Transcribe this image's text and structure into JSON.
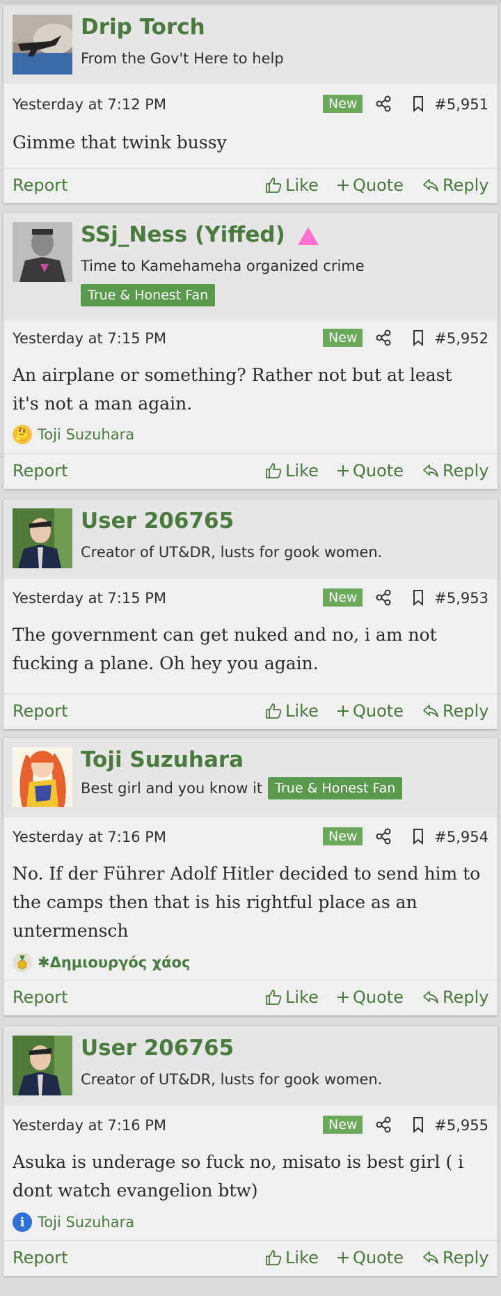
{
  "posts": [
    {
      "username": "Drip Torch",
      "user_title": "From the Gov't Here to help",
      "banner": "",
      "date": "Yesterday at 7:12 PM",
      "new_label": "New",
      "number": "#5,951",
      "body": "Gimme that twink bussy",
      "reaction_users": "",
      "actions": {
        "report": "Report",
        "like": "Like",
        "quote": "Quote",
        "reply": "Reply"
      }
    },
    {
      "username": "SSj_Ness (Yiffed)",
      "user_title": "Time to Kamehameha organized crime",
      "banner": "True & Honest Fan",
      "date": "Yesterday at 7:15 PM",
      "new_label": "New",
      "number": "#5,952",
      "body": "An airplane or something? Rather not but at least it's not a man again.",
      "reaction_users": "Toji Suzuhara",
      "actions": {
        "report": "Report",
        "like": "Like",
        "quote": "Quote",
        "reply": "Reply"
      }
    },
    {
      "username": "User 206765",
      "user_title": "Creator of UT&DR, lusts for gook women.",
      "banner": "",
      "date": "Yesterday at 7:15 PM",
      "new_label": "New",
      "number": "#5,953",
      "body": "The government can get nuked and no, i am not fucking a plane. Oh hey you again.",
      "reaction_users": "",
      "actions": {
        "report": "Report",
        "like": "Like",
        "quote": "Quote",
        "reply": "Reply"
      }
    },
    {
      "username": "Toji Suzuhara",
      "user_title": "Best girl and you know it",
      "banner": "True & Honest Fan",
      "date": "Yesterday at 7:16 PM",
      "new_label": "New",
      "number": "#5,954",
      "body": "No. If der Führer Adolf Hitler decided to send him to the camps then that is his rightful place as an untermensch",
      "reaction_users": "✱Δημιουργός χάος",
      "actions": {
        "report": "Report",
        "like": "Like",
        "quote": "Quote",
        "reply": "Reply"
      }
    },
    {
      "username": "User 206765",
      "user_title": "Creator of UT&DR, lusts for gook women.",
      "banner": "",
      "date": "Yesterday at 7:16 PM",
      "new_label": "New",
      "number": "#5,955",
      "body": "Asuka is underage so fuck no, misato is best girl ( i dont watch evangelion btw)",
      "reaction_users": "Toji Suzuhara",
      "actions": {
        "report": "Report",
        "like": "Like",
        "quote": "Quote",
        "reply": "Reply"
      }
    }
  ],
  "colors": {
    "username": "#4a7a3e",
    "banner": "#5a9a4c",
    "new_badge": "#6aa95a",
    "alert_icon": "#ff6fd1"
  }
}
